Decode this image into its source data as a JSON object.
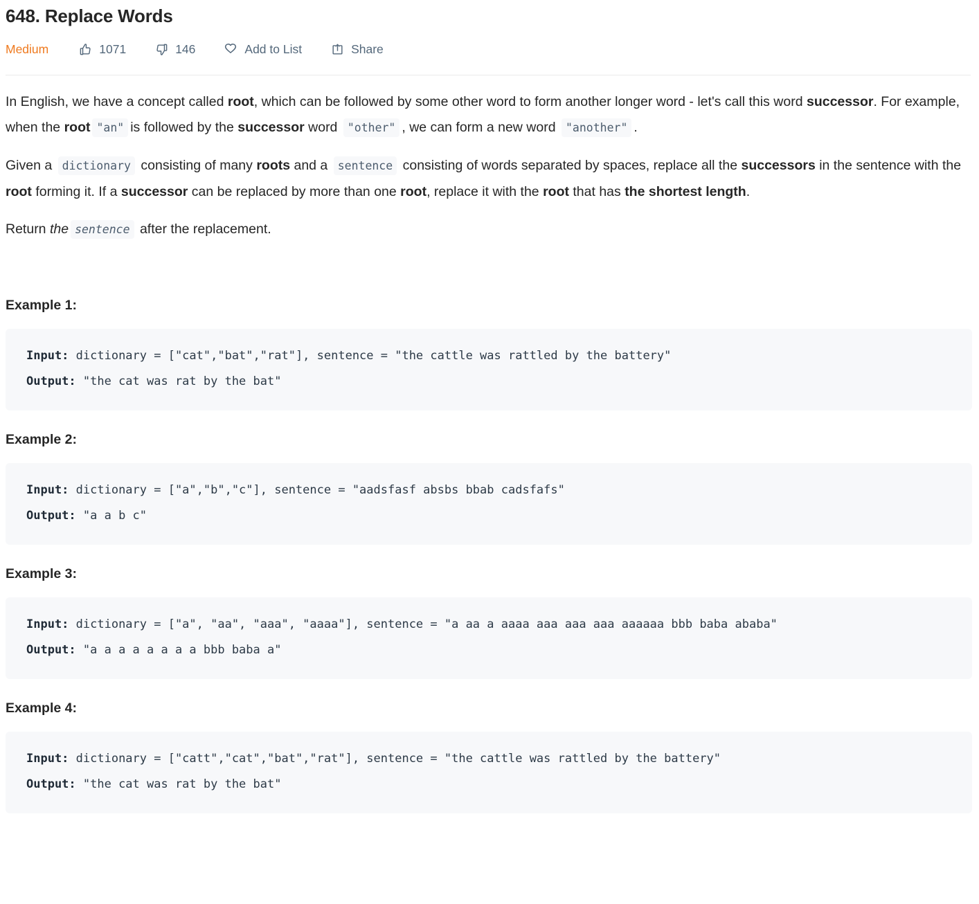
{
  "problem": {
    "title": "648. Replace Words",
    "difficulty": "Medium"
  },
  "toolbar": {
    "likes": "1071",
    "dislikes": "146",
    "add_to_list": "Add to List",
    "share": "Share"
  },
  "description": {
    "p1": {
      "s1": "In English, we have a concept called ",
      "b1": "root",
      "s2": ", which can be followed by some other word to form another longer word - let's call this word ",
      "b2": "successor",
      "s3": ". For example, when the ",
      "b3": "root",
      "c1": "\"an\"",
      "s4": "is followed by the ",
      "b4": "successor",
      "s5": " word ",
      "c2": "\"other\"",
      "s6": ", we can form a new word ",
      "c3": "\"another\"",
      "s7": "."
    },
    "p2": {
      "s1": "Given a ",
      "c1": "dictionary",
      "s2": " consisting of many ",
      "b1": "roots",
      "s3": " and a ",
      "c2": "sentence",
      "s4": " consisting of words separated by spaces, replace all the ",
      "b2": "successors",
      "s5": " in the sentence with the ",
      "b3": "root",
      "s6": " forming it. If a ",
      "b4": "successor",
      "s7": " can be replaced by more than one ",
      "b5": "root",
      "s8": ", replace it with the ",
      "b6": "root",
      "s9": " that has ",
      "b7": "the shortest length",
      "s10": "."
    },
    "p3": {
      "s1": "Return ",
      "i1": "the",
      "c1": "sentence",
      "s2": " after the replacement."
    }
  },
  "examples": [
    {
      "heading": "Example 1:",
      "input_label": "Input:",
      "input_value": " dictionary = [\"cat\",\"bat\",\"rat\"], sentence = \"the cattle was rattled by the battery\"",
      "output_label": "Output:",
      "output_value": " \"the cat was rat by the bat\""
    },
    {
      "heading": "Example 2:",
      "input_label": "Input:",
      "input_value": " dictionary = [\"a\",\"b\",\"c\"], sentence = \"aadsfasf absbs bbab cadsfafs\"",
      "output_label": "Output:",
      "output_value": " \"a a b c\""
    },
    {
      "heading": "Example 3:",
      "input_label": "Input:",
      "input_value": " dictionary = [\"a\", \"aa\", \"aaa\", \"aaaa\"], sentence = \"a aa a aaaa aaa aaa aaa aaaaaa bbb baba ababa\"",
      "output_label": "Output:",
      "output_value": " \"a a a a a a a a bbb baba a\""
    },
    {
      "heading": "Example 4:",
      "input_label": "Input:",
      "input_value": " dictionary = [\"catt\",\"cat\",\"bat\",\"rat\"], sentence = \"the cattle was rattled by the battery\"",
      "output_label": "Output:",
      "output_value": " \"the cat was rat by the bat\""
    }
  ],
  "colors": {
    "difficulty": "#ef7a1f",
    "meta_text": "#54687b",
    "code_bg": "#f7f8fa",
    "body_text": "#262626"
  }
}
